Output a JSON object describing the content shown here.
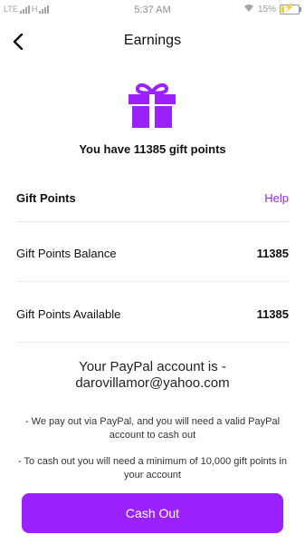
{
  "status_bar": {
    "network": "LTE",
    "network2": "H",
    "time": "5:37 AM",
    "battery": "15%",
    "battery_level": 0.15
  },
  "header": {
    "title": "Earnings",
    "back_icon": "chevron-left-icon"
  },
  "summary": {
    "gift_icon": "gift-icon",
    "text": "You have 11385 gift points"
  },
  "gift_points_section": {
    "title": "Gift Points",
    "help_label": "Help",
    "rows": [
      {
        "label": "Gift Points Balance",
        "value": "11385"
      },
      {
        "label": "Gift Points Available",
        "value": "11385"
      }
    ]
  },
  "paypal": {
    "line1": "Your PayPal account is -",
    "email": "darovillamor@yahoo.com"
  },
  "notes": [
    "- We pay out via PayPal, and you will need a valid PayPal account to cash out",
    "- To cash out you will need a minimum of 10,000 gift points in your account"
  ],
  "cashout_button": {
    "label": "Cash Out"
  },
  "colors": {
    "accent": "#9b22ff",
    "help_link": "#8e2de2"
  }
}
